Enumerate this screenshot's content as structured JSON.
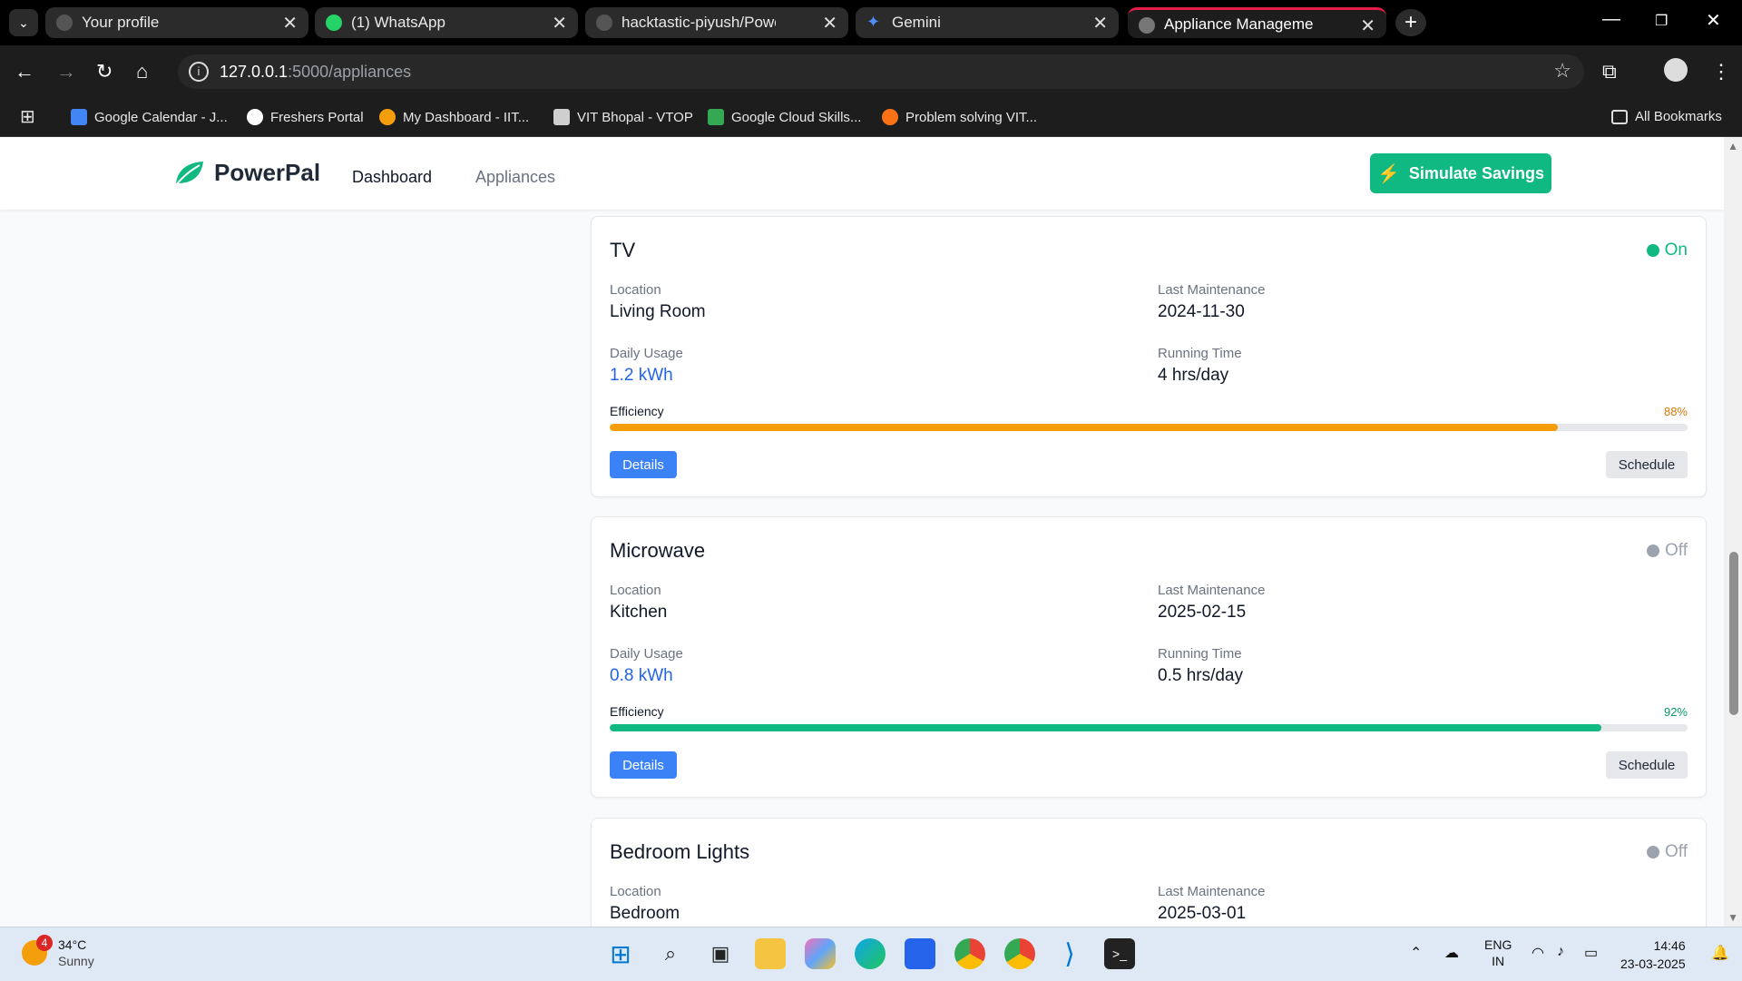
{
  "browser": {
    "tabs": [
      {
        "label": "Your profile",
        "icon": "github-icon"
      },
      {
        "label": "(1) WhatsApp",
        "icon": "whatsapp-icon"
      },
      {
        "label": "hacktastic-piyush/PowerPal-Pro",
        "icon": "github-icon"
      },
      {
        "label": "Gemini",
        "icon": "gemini-icon"
      },
      {
        "label": "Appliance Management - Energ",
        "icon": "globe-icon"
      }
    ],
    "url_host": "127.0.0.1",
    "url_path": ":5000/appliances",
    "bookmarks": [
      {
        "label": "Google Calendar - J...",
        "color": "#4285f4"
      },
      {
        "label": "Freshers Portal",
        "color": "#ffffff"
      },
      {
        "label": "My Dashboard - IIT...",
        "color": "#f59e0b"
      },
      {
        "label": "VIT Bhopal - VTOP",
        "color": "#cfcfcf"
      },
      {
        "label": "Google Cloud Skills...",
        "color": "#34a853"
      },
      {
        "label": "Problem solving VIT...",
        "color": "#f97316"
      }
    ],
    "all_bookmarks": "All Bookmarks"
  },
  "app": {
    "brand": "PowerPal",
    "nav": [
      "Dashboard",
      "Appliances"
    ],
    "simulate_label": "Simulate Savings",
    "accent": "#10b981"
  },
  "labels": {
    "location": "Location",
    "last_maintenance": "Last Maintenance",
    "daily_usage": "Daily Usage",
    "running_time": "Running Time",
    "efficiency": "Efficiency",
    "details": "Details",
    "schedule": "Schedule"
  },
  "appliances": [
    {
      "name": "TV",
      "status": "On",
      "status_color": "#10b981",
      "location": "Living Room",
      "last_maintenance": "2024-11-30",
      "daily_usage": "1.2 kWh",
      "running_time": "4 hrs/day",
      "efficiency": 88,
      "efficiency_label": "88%",
      "efficiency_color": "#f59e0b",
      "pct_color": "#d97706"
    },
    {
      "name": "Microwave",
      "status": "Off",
      "status_color": "#9ca3af",
      "location": "Kitchen",
      "last_maintenance": "2025-02-15",
      "daily_usage": "0.8 kWh",
      "running_time": "0.5 hrs/day",
      "efficiency": 92,
      "efficiency_label": "92%",
      "efficiency_color": "#10b981",
      "pct_color": "#059669"
    },
    {
      "name": "Bedroom Lights",
      "status": "Off",
      "status_color": "#9ca3af",
      "location": "Bedroom",
      "last_maintenance": "2025-03-01"
    }
  ],
  "taskbar": {
    "weather_temp": "34°C",
    "weather_cond": "Sunny",
    "weather_badge": "4",
    "lang_line1": "ENG",
    "lang_line2": "IN",
    "time": "14:46",
    "date": "23-03-2025"
  }
}
